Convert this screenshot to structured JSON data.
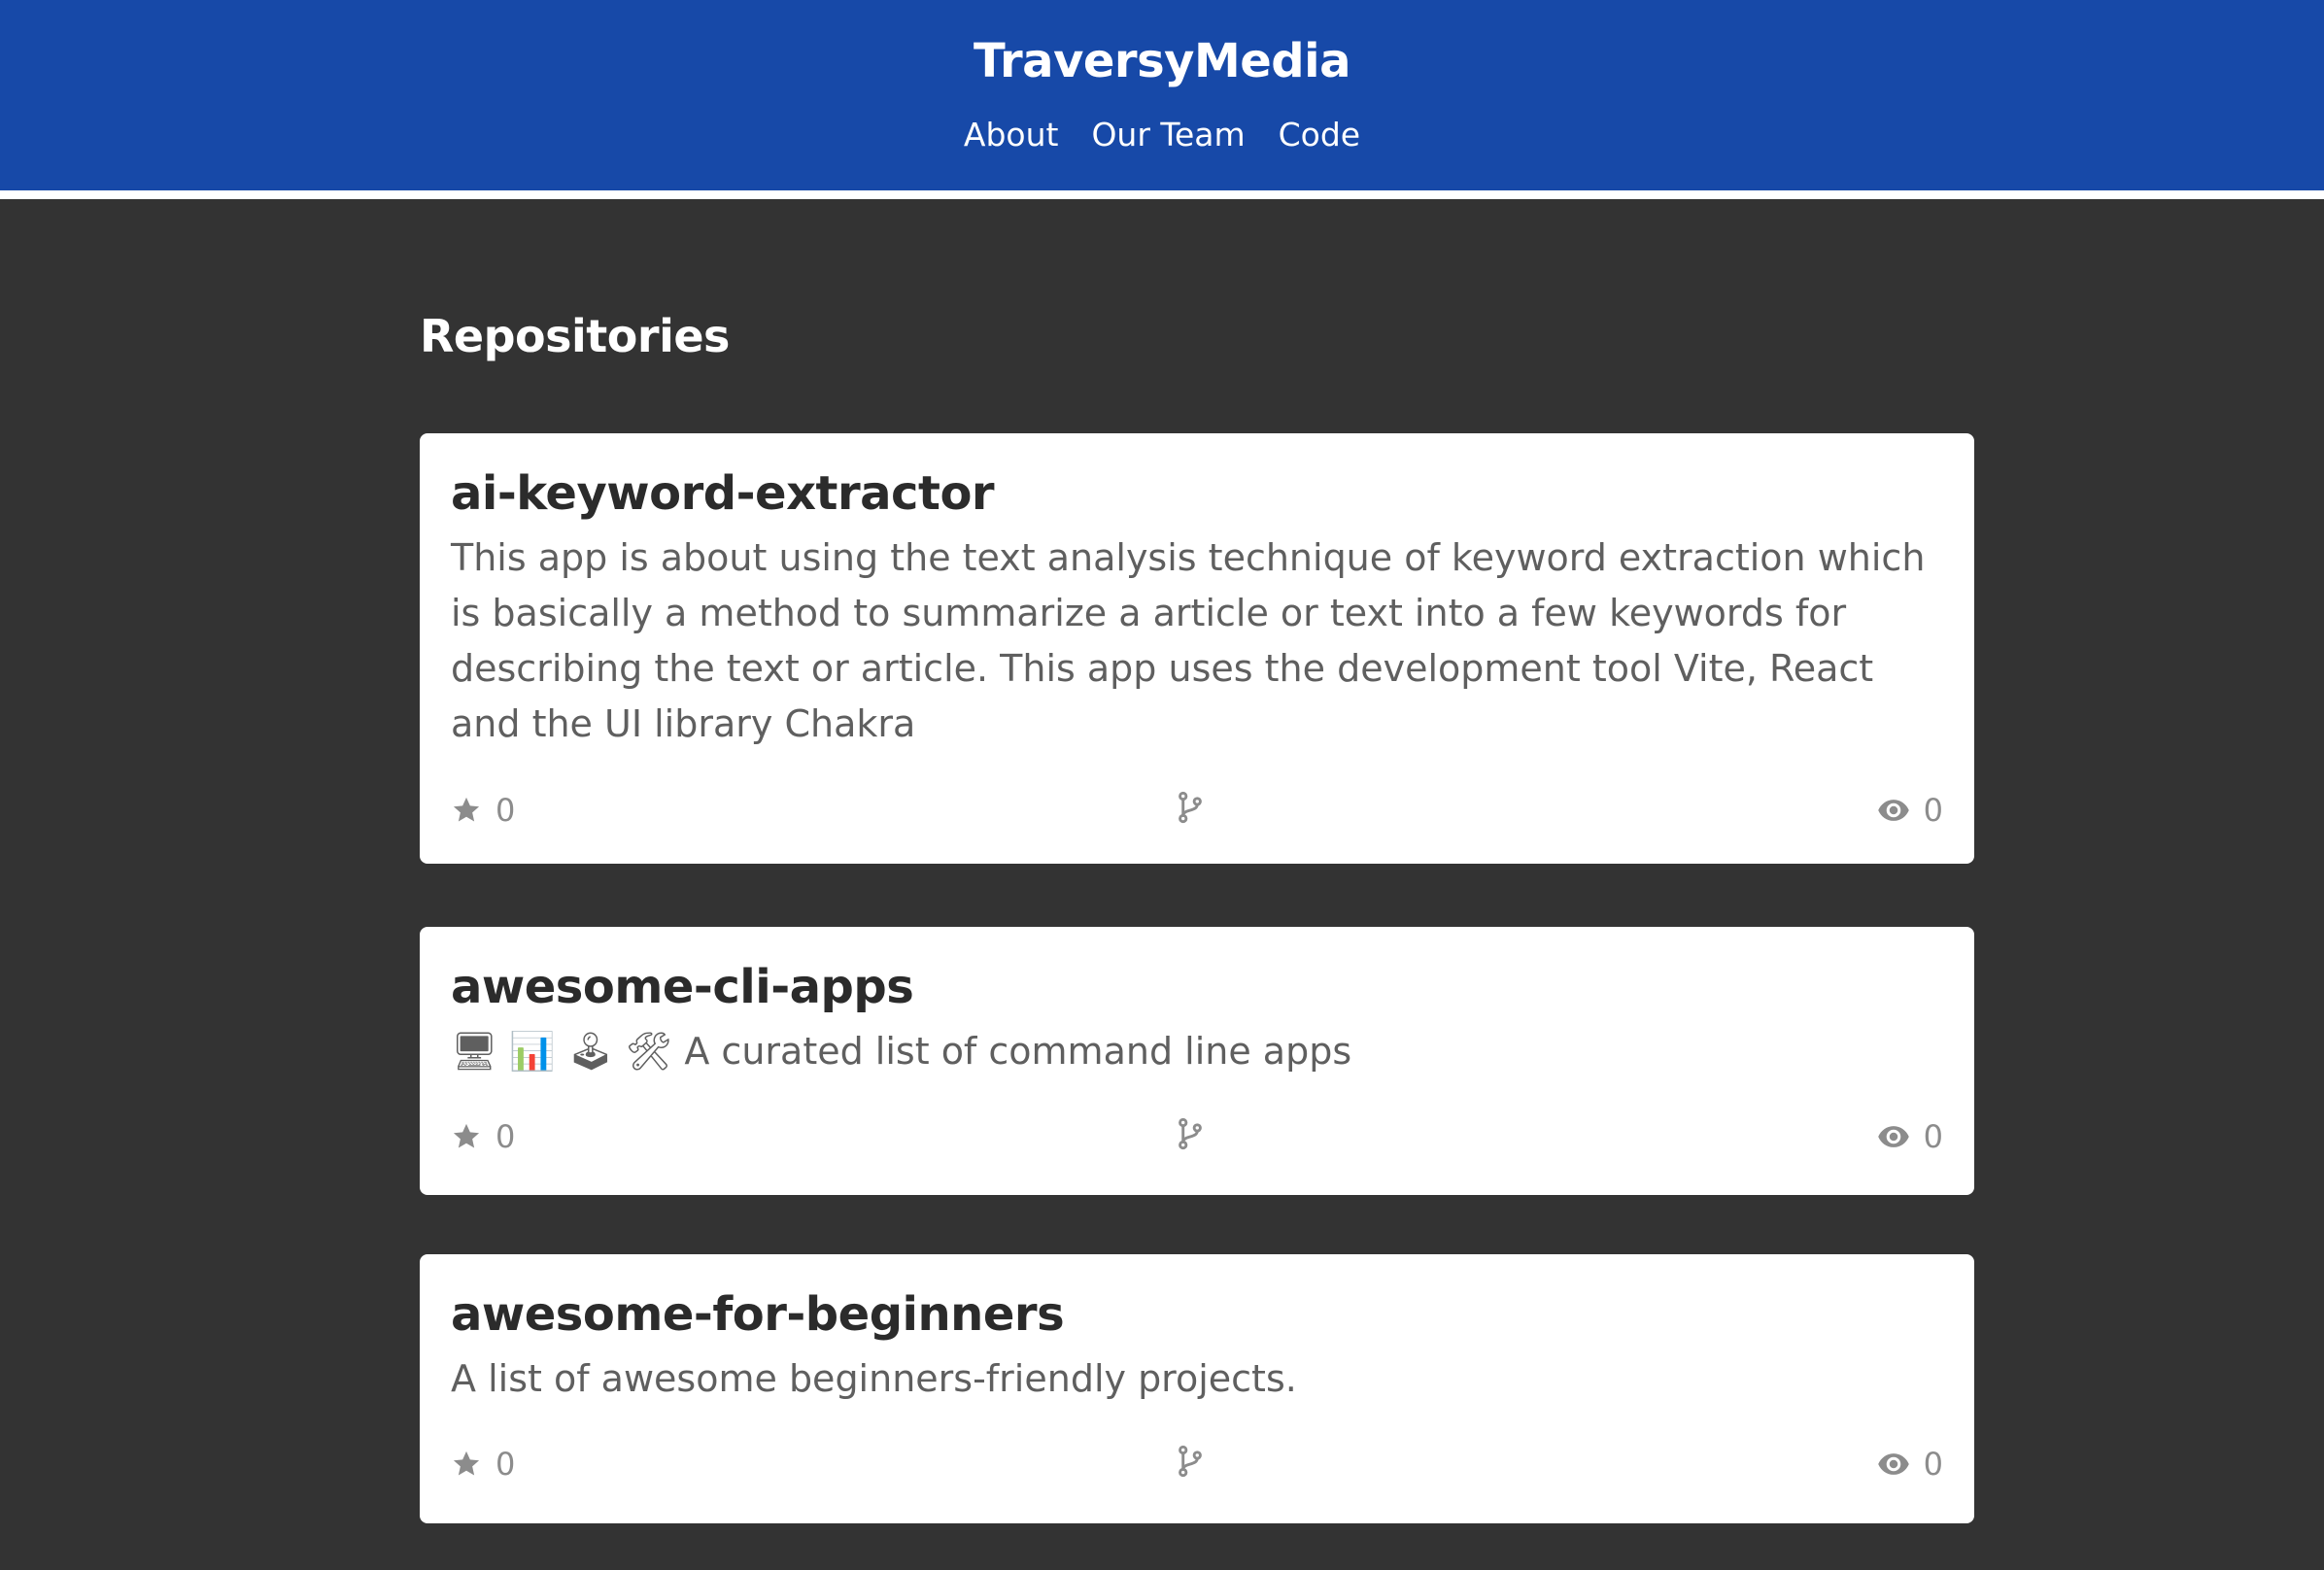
{
  "header": {
    "brand": "TraversyMedia",
    "nav": [
      {
        "label": "About"
      },
      {
        "label": "Our Team"
      },
      {
        "label": "Code"
      }
    ]
  },
  "main": {
    "title": "Repositories",
    "repos": [
      {
        "name": "ai-keyword-extractor",
        "description": "This app is about using the text analysis technique of keyword extraction which is basically a method to summarize a article or text into a few keywords for describing the text or article. This app uses the development tool Vite, React and the UI library Chakra",
        "stars": "0",
        "forks": "",
        "watchers": "0"
      },
      {
        "name": "awesome-cli-apps",
        "description": "🖥 📊 🕹 🛠 A curated list of command line apps",
        "stars": "0",
        "forks": "",
        "watchers": "0"
      },
      {
        "name": "awesome-for-beginners",
        "description": "A list of awesome beginners-friendly projects.",
        "stars": "0",
        "forks": "",
        "watchers": "0"
      }
    ]
  },
  "icons": {
    "star": "star-icon",
    "fork": "fork-icon",
    "watch": "eye-icon"
  },
  "colors": {
    "header_bg": "#1749a8",
    "page_bg": "#333333",
    "card_bg": "#ffffff",
    "title_text": "#2b2b2b",
    "body_text": "#5f5f5f",
    "muted_text": "#8c8c8c"
  }
}
